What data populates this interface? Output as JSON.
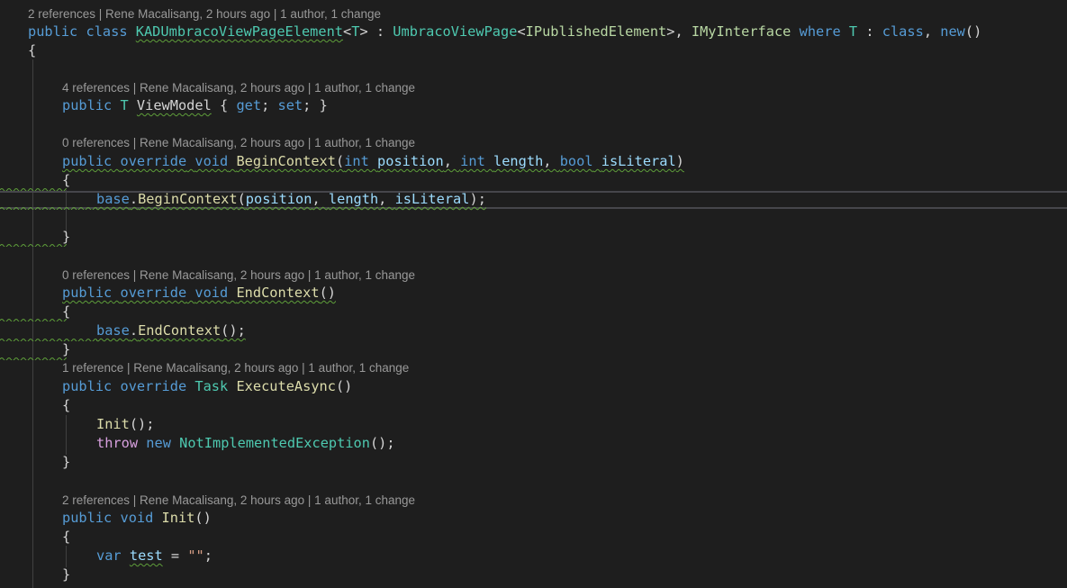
{
  "codelens": {
    "class_lens": "2 references | Rene Macalisang, 2 hours ago | 1 author, 1 change",
    "viewmodel_lens": "4 references | Rene Macalisang, 2 hours ago | 1 author, 1 change",
    "begincontext_lens": "0 references | Rene Macalisang, 2 hours ago | 1 author, 1 change",
    "endcontext_lens": "0 references | Rene Macalisang, 2 hours ago | 1 author, 1 change",
    "executeasync_lens": "1 reference | Rene Macalisang, 2 hours ago | 1 author, 1 change",
    "init_lens": "2 references | Rene Macalisang, 2 hours ago | 1 author, 1 change"
  },
  "code": {
    "public": "public",
    "class": "class",
    "override": "override",
    "void": "void",
    "int": "int",
    "bool": "bool",
    "new": "new",
    "where": "where",
    "get": "get",
    "set": "set",
    "base": "base",
    "throw": "throw",
    "var": "var",
    "class_name": "KADUmbracoViewPageElement",
    "type_param": "T",
    "base_class": "UmbracoViewPage",
    "published_element": "IPublishedElement",
    "my_interface": "IMyInterface",
    "viewmodel": "ViewModel",
    "begin_context": "BeginContext",
    "end_context": "EndContext",
    "task": "Task",
    "execute_async": "ExecuteAsync",
    "init": "Init",
    "not_impl_exception": "NotImplementedException",
    "position": "position",
    "length": "length",
    "is_literal": "isLiteral",
    "test": "test",
    "empty_string": "\"\""
  },
  "colors": {
    "background": "#1e1e1e",
    "keyword": "#569cd6",
    "control_keyword": "#d8a0df",
    "type": "#4ec9b0",
    "interface": "#b8d7a3",
    "method": "#dcdcaa",
    "parameter": "#9cdcfe",
    "string": "#d69d85",
    "codelens": "#999999",
    "squiggle": "#5e9e3a"
  }
}
